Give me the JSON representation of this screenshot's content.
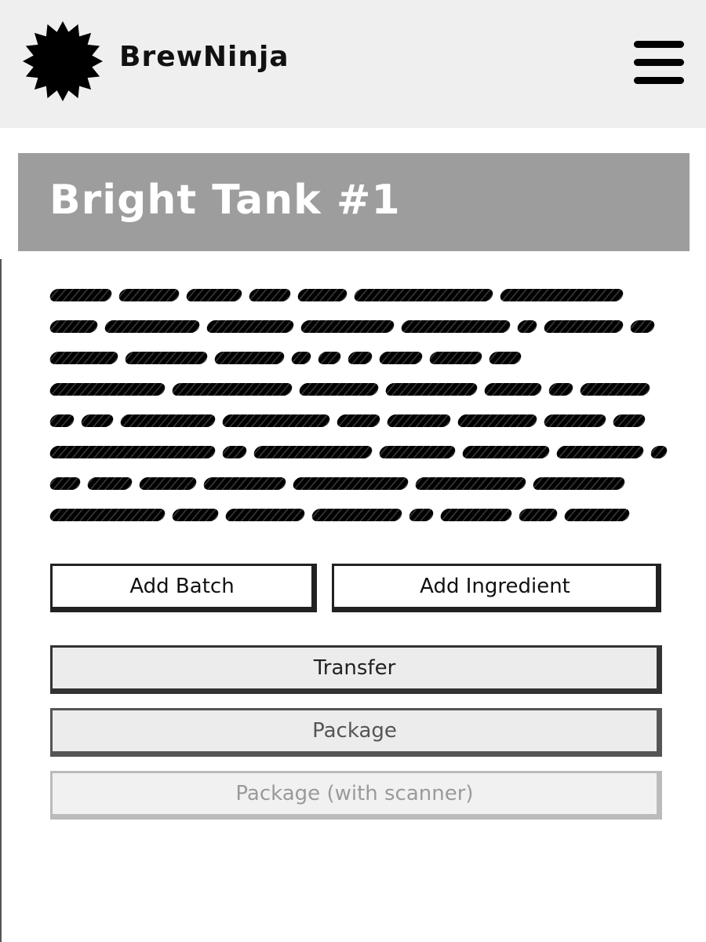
{
  "header": {
    "brand_name": "BrewNinja",
    "logo_icon": "starburst-logo-icon",
    "menu_icon": "hamburger-menu-icon"
  },
  "title_panel": {
    "title": "Bright Tank #1"
  },
  "actions": {
    "add_batch_label": "Add Batch",
    "add_ingredient_label": "Add Ingredient",
    "transfer_label": "Transfer",
    "package_label": "Package",
    "package_scanner_label": "Package (with scanner)"
  },
  "colors": {
    "header_bg": "#efefef",
    "title_panel_bg": "#9d9d9d",
    "title_text": "#ffffff"
  }
}
